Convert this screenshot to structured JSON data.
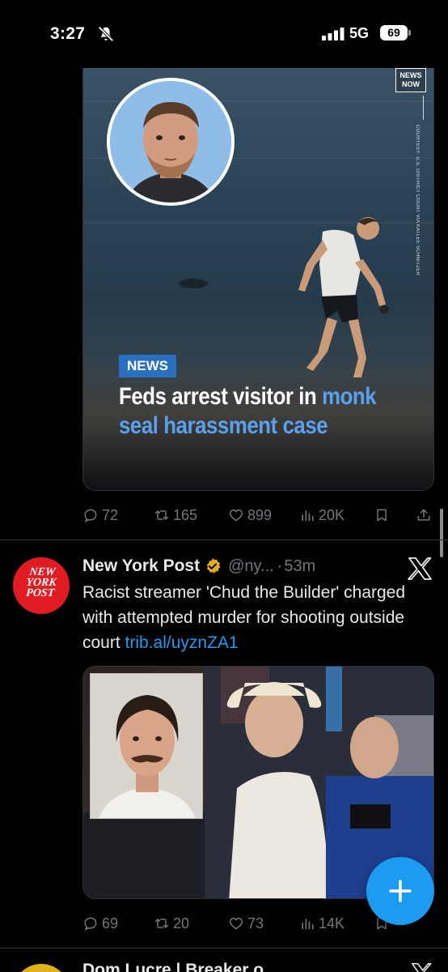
{
  "status_bar": {
    "time": "3:27",
    "network": "5G",
    "battery": "69"
  },
  "tweet1": {
    "media": {
      "watermark": "NEWS NOW",
      "courtesy": "COURTESY: U.S. DISTRICT COURT VIA KATLEE SCHNITZER",
      "tag": "NEWS",
      "headline_plain": "Feds arrest visitor in ",
      "headline_accent": "monk seal harassment case"
    },
    "actions": {
      "replies": "72",
      "reposts": "165",
      "likes": "899",
      "views": "20K"
    }
  },
  "tweet2": {
    "avatar_text": "NEW YORK POST",
    "author": "New York Post",
    "handle": "@ny...",
    "separator": "·",
    "time": "53m",
    "text": "Racist streamer 'Chud the Builder' charged with attempted murder for shooting outside court ",
    "link": "trib.al/uyznZA1",
    "actions": {
      "replies": "69",
      "reposts": "20",
      "likes": "73",
      "views": "14K"
    }
  },
  "tweet3": {
    "author_partial": "Dom Lucre | Breaker o"
  },
  "colors": {
    "background": "#000000",
    "text": "#e7e9ea",
    "muted": "#71767b",
    "accent": "#1d9bf0",
    "nyp_red": "#e01b22",
    "verified_gold": "#e8b020"
  },
  "icons": [
    "bell-slash-icon",
    "signal-icon",
    "reply-icon",
    "repost-icon",
    "like-icon",
    "views-icon",
    "bookmark-icon",
    "share-icon",
    "verified-badge-icon",
    "x-logo-icon",
    "compose-plus-icon"
  ]
}
